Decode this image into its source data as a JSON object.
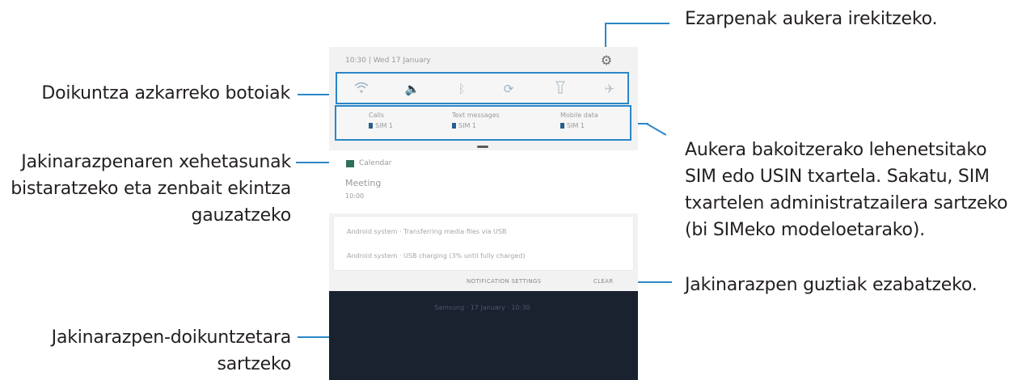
{
  "callouts": {
    "settings": "Ezarpenak aukera irekitzeko.",
    "quick_settings": "Doikuntza azkarreko botoiak",
    "sim_preference": "Aukera bakoitzerako lehenetsitako\nSIM edo USIN txartela. Sakatu, SIM\ntxartelen administratzailera sartzeko\n(bi SIMeko modeloetarako).",
    "notification_details": "Jakinarazpenaren xehetasunak\nbistaratzeko eta zenbait ekintza\ngauzatzeko",
    "clear_all": "Jakinarazpen guztiak ezabatzeko.",
    "notification_settings": "Jakinarazpen-doikuntzetara\nsartzeko"
  },
  "phone": {
    "status": "10:30 | Wed 17 January",
    "quick_settings_icons": [
      "wifi-icon",
      "sound-icon",
      "bluetooth-icon",
      "auto-rotate-icon",
      "flashlight-icon",
      "airplane-icon"
    ],
    "sim_columns": [
      {
        "label": "Calls",
        "sim": "SIM 1"
      },
      {
        "label": "Text messages",
        "sim": "SIM 1"
      },
      {
        "label": "Mobile data",
        "sim": "SIM 1"
      }
    ],
    "notification": {
      "app": "Calendar",
      "title": "Meeting",
      "time": "10:00"
    },
    "system_rows": [
      "Android system · Transferring media files via USB",
      "Android system · USB charging (3% until fully charged)"
    ],
    "actions": {
      "settings": "NOTIFICATION SETTINGS",
      "clear": "CLEAR"
    },
    "lock_text": "Samsung · 17 January · 10:30"
  },
  "colors": {
    "accent": "#2b87c7",
    "lockscreen": "#1a2230"
  }
}
